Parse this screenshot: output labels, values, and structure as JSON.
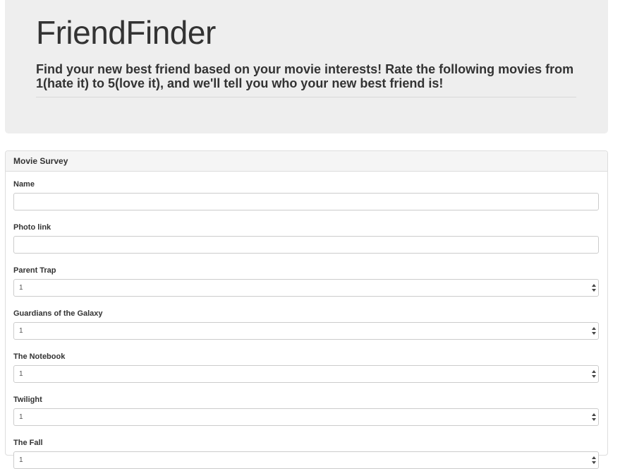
{
  "header": {
    "title": "FriendFinder",
    "lead": "Find your new best friend based on your movie interests! Rate the following movies from 1(hate it) to 5(love it), and we'll tell you who your new best friend is!"
  },
  "survey": {
    "heading": "Movie Survey",
    "name_label": "Name",
    "name_value": "",
    "photo_label": "Photo link",
    "photo_value": "",
    "questions": [
      {
        "label": "Parent Trap",
        "value": "1"
      },
      {
        "label": "Guardians of the Galaxy",
        "value": "1"
      },
      {
        "label": "The Notebook",
        "value": "1"
      },
      {
        "label": "Twilight",
        "value": "1"
      },
      {
        "label": "The Fall",
        "value": "1"
      }
    ]
  }
}
